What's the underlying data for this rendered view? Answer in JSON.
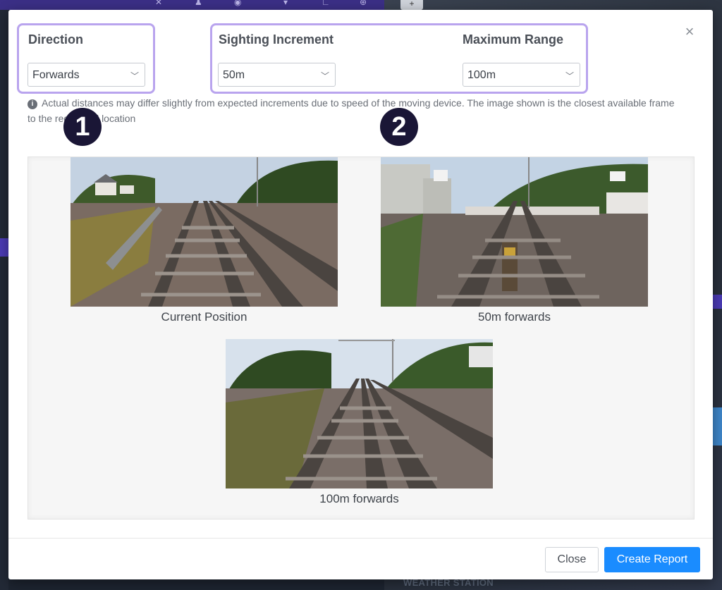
{
  "background": {
    "bottom_label": "WEATHER STATION"
  },
  "modal": {
    "close_glyph": "×",
    "direction": {
      "label": "Direction",
      "value": "Forwards"
    },
    "sighting_increment": {
      "label": "Sighting Increment",
      "value": "50m"
    },
    "maximum_range": {
      "label": "Maximum Range",
      "value": "100m"
    },
    "info_text": "Actual distances may differ slightly from expected increments due to speed of the moving device. The image shown is the closest available frame to the requested location",
    "step_badges": [
      "1",
      "2"
    ],
    "photos": [
      {
        "caption": "Current Position"
      },
      {
        "caption": "50m forwards"
      },
      {
        "caption": "100m forwards"
      }
    ],
    "buttons": {
      "close": "Close",
      "create_report": "Create Report"
    }
  },
  "colors": {
    "highlight_border": "#b9a4ee",
    "primary_button": "#1a8cff",
    "badge_bg": "#1a1636"
  },
  "icons": {
    "close": "close-icon",
    "info": "info-icon",
    "chevron": "chevron-down-icon"
  }
}
